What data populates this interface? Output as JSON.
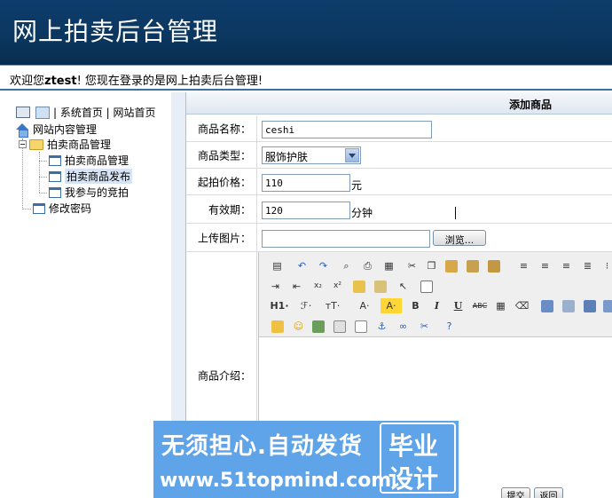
{
  "header": {
    "title": "网上拍卖后台管理"
  },
  "welcome": {
    "prefix": "欢迎您",
    "user": "ztest",
    "suffix": "! 您现在登录的是网上拍卖后台管理!"
  },
  "sidebar": {
    "top_links": "| 系统首页 | 网站首页",
    "root": "网站内容管理",
    "group": "拍卖商品管理",
    "items": [
      "拍卖商品管理",
      "拍卖商品发布",
      "我参与的竞拍"
    ],
    "change_password": "修改密码"
  },
  "panel": {
    "title": "添加商品"
  },
  "form": {
    "name_label": "商品名称：",
    "name_value": "ceshi",
    "type_label": "商品类型：",
    "type_value": "服饰护肤",
    "price_label": "起拍价格：",
    "price_value": "110",
    "price_unit": "元",
    "period_label": "有效期：",
    "period_value": "120",
    "period_unit": "分钟",
    "upload_label": "上传图片：",
    "browse_label": "浏览...",
    "desc_label": "商品介绍："
  },
  "toolbar": {
    "row3": {
      "h1": "H1·",
      "font": "ℱ·",
      "size": "тT·",
      "fontcolor": "A·",
      "bgcolor": "A·",
      "bold": "B",
      "italic": "I",
      "underline": "U",
      "strike": "ABC"
    }
  },
  "buttons": {
    "submit": "提交",
    "back": "返回"
  },
  "watermark": {
    "line1": "无须担心.自动发货",
    "line2": "www.51topmind.com",
    "badge_line1": "毕业",
    "badge_line2": "设计"
  }
}
